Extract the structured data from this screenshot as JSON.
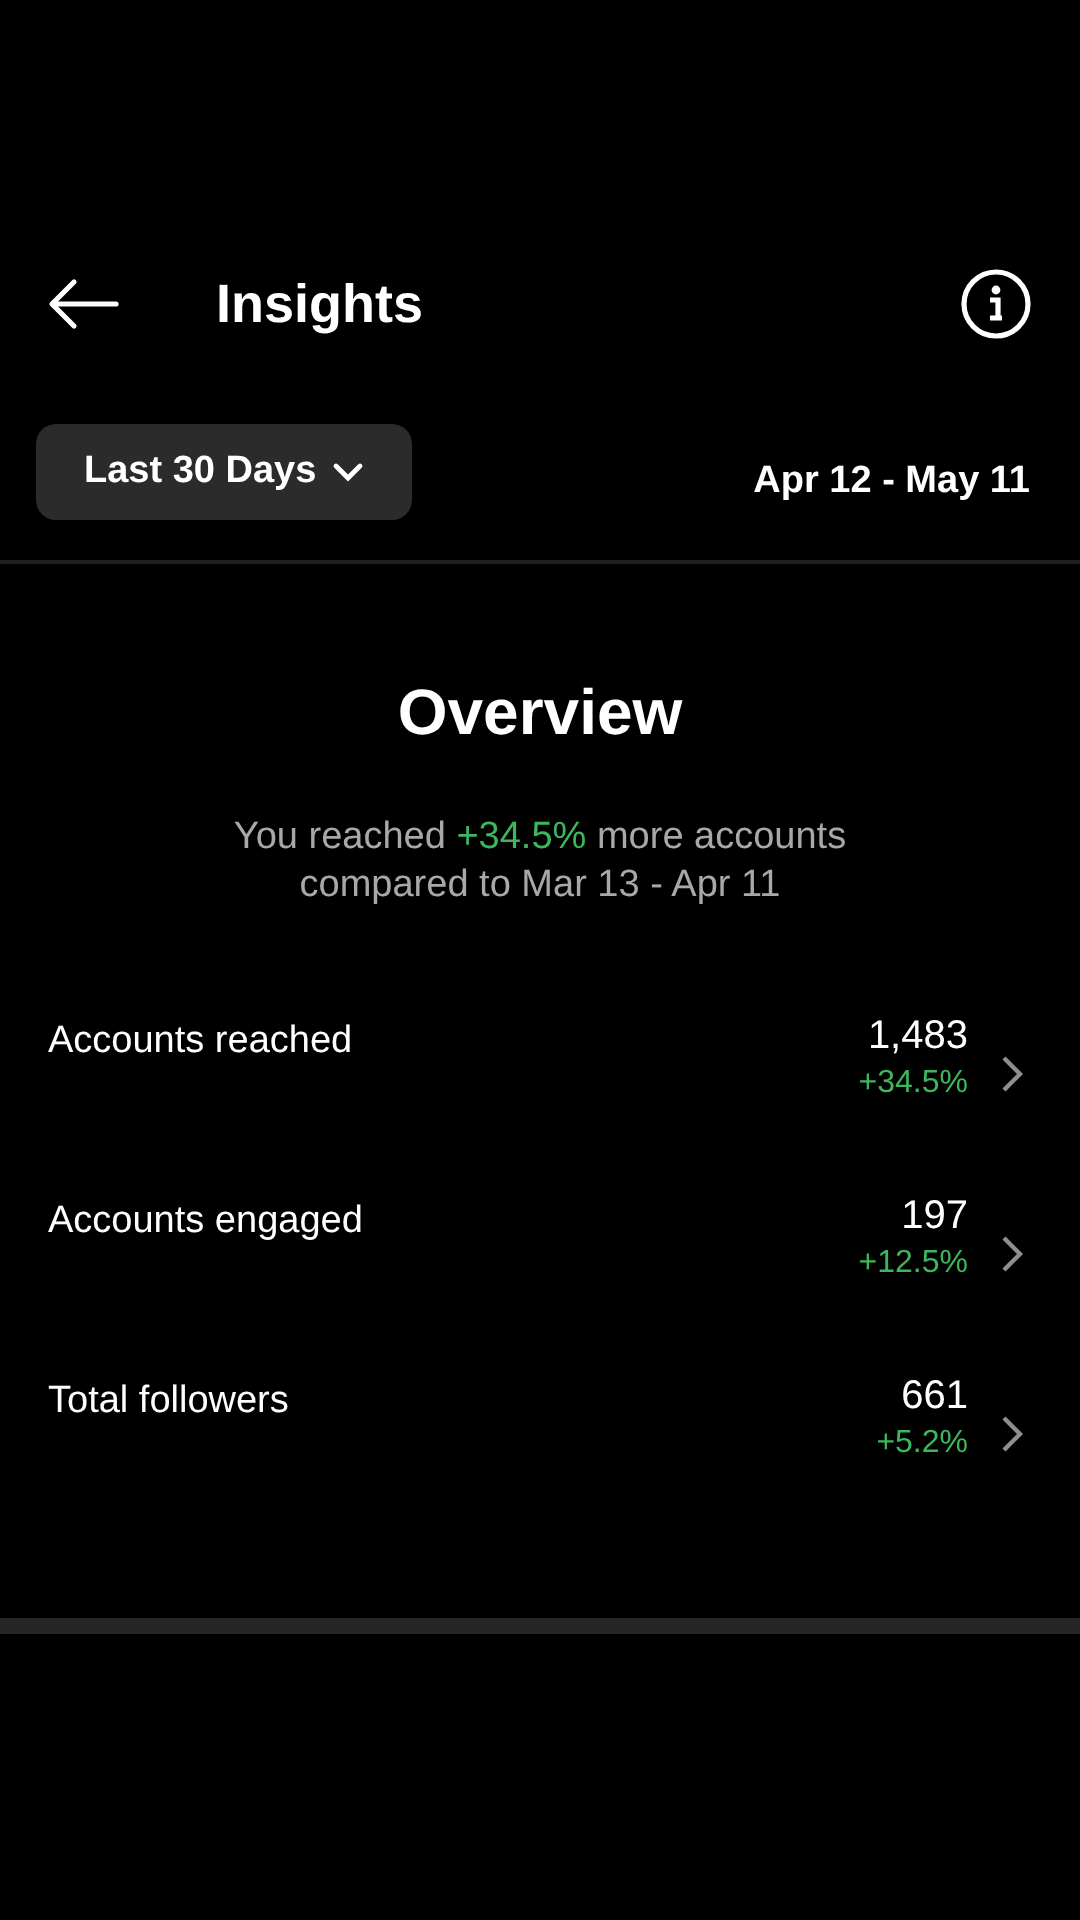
{
  "header": {
    "title": "Insights"
  },
  "filter": {
    "range": "Last 30 Days",
    "dates": "Apr 12 - May 11"
  },
  "overview": {
    "title": "Overview",
    "summary_before": "You reached",
    "summary_highlight": "+34.5%",
    "summary_after": "more accounts compared to Mar 13 - Apr 11"
  },
  "metrics": [
    {
      "label": "Accounts reached",
      "value": "1,483",
      "change": "+34.5%"
    },
    {
      "label": "Accounts engaged",
      "value": "197",
      "change": "+12.5%"
    },
    {
      "label": "Total followers",
      "value": "661",
      "change": "+5.2%"
    }
  ]
}
